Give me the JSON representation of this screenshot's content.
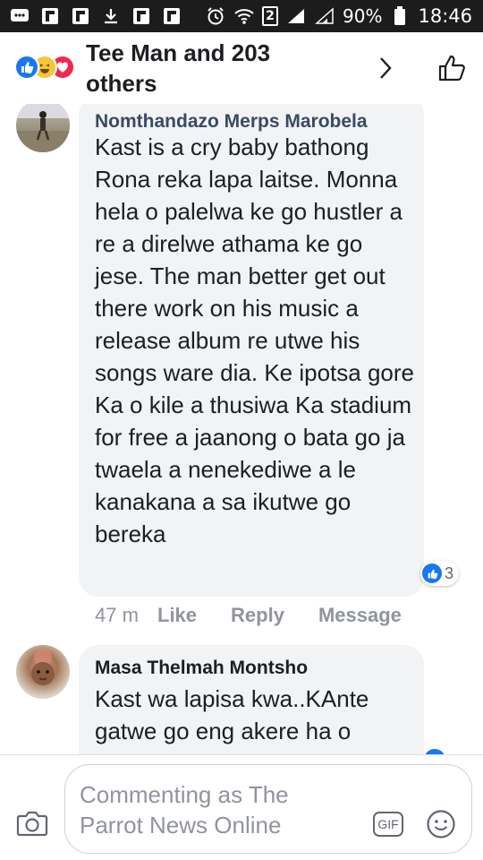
{
  "status_bar": {
    "left_icons": [
      "notification-icon",
      "flipboard-icon",
      "flipboard-icon",
      "download-icon",
      "flipboard-icon",
      "flipboard-icon"
    ],
    "sim_label": "2",
    "battery_percent": "90%",
    "time": "18:46"
  },
  "header": {
    "title": "Tee Man and 203 others",
    "reaction_icons": [
      "like-reaction-icon",
      "haha-reaction-icon",
      "love-reaction-icon"
    ]
  },
  "comments": [
    {
      "author": "Nomthandazo Merps Marobela",
      "text": "Kast is a cry baby bathong Rona reka lapa laitse. Monna hela o palelwa ke go hustler a re a direlwe athama ke go jese. The man better get out there work on his music a release album re utwe his songs ware dia. Ke ipotsa gore Ka o kile a thusiwa Ka stadium for free a jaanong o bata go ja twaela a nenekediwe a le kanakana a sa ikutwe go bereka",
      "reaction_count": "3",
      "time": "47 m",
      "actions": [
        "Like",
        "Reply",
        "Message"
      ]
    },
    {
      "author": "Masa Thelmah Montsho",
      "text": "Kast wa lapisa kwa..KAnte gatwe go eng akere ha o"
    }
  ],
  "composer": {
    "placeholder": "Commenting as The Parrot News Online",
    "gif_label": "GIF"
  },
  "colors": {
    "facebook_blue": "#1877f2",
    "bubble_bg": "#f2f3f5",
    "meta_grey": "#90949c"
  }
}
